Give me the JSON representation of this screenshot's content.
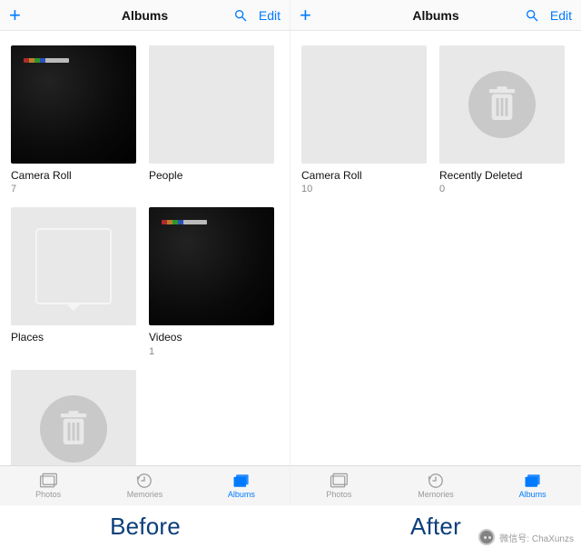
{
  "navbar": {
    "title": "Albums",
    "edit": "Edit"
  },
  "tabs": {
    "photos": "Photos",
    "memories": "Memories",
    "albums": "Albums"
  },
  "left": {
    "albums": [
      {
        "label": "Camera Roll",
        "count": "7",
        "kind": "dark"
      },
      {
        "label": "People",
        "count": "",
        "kind": "people"
      },
      {
        "label": "Places",
        "count": "",
        "kind": "places"
      },
      {
        "label": "Videos",
        "count": "1",
        "kind": "dark"
      },
      {
        "label": "",
        "count": "",
        "kind": "trash"
      }
    ]
  },
  "right": {
    "albums": [
      {
        "label": "Camera Roll",
        "count": "10",
        "kind": "plain"
      },
      {
        "label": "Recently Deleted",
        "count": "0",
        "kind": "trash"
      }
    ]
  },
  "footer": {
    "left": "Before",
    "right": "After"
  },
  "watermark": "微信号: ChaXunzs"
}
